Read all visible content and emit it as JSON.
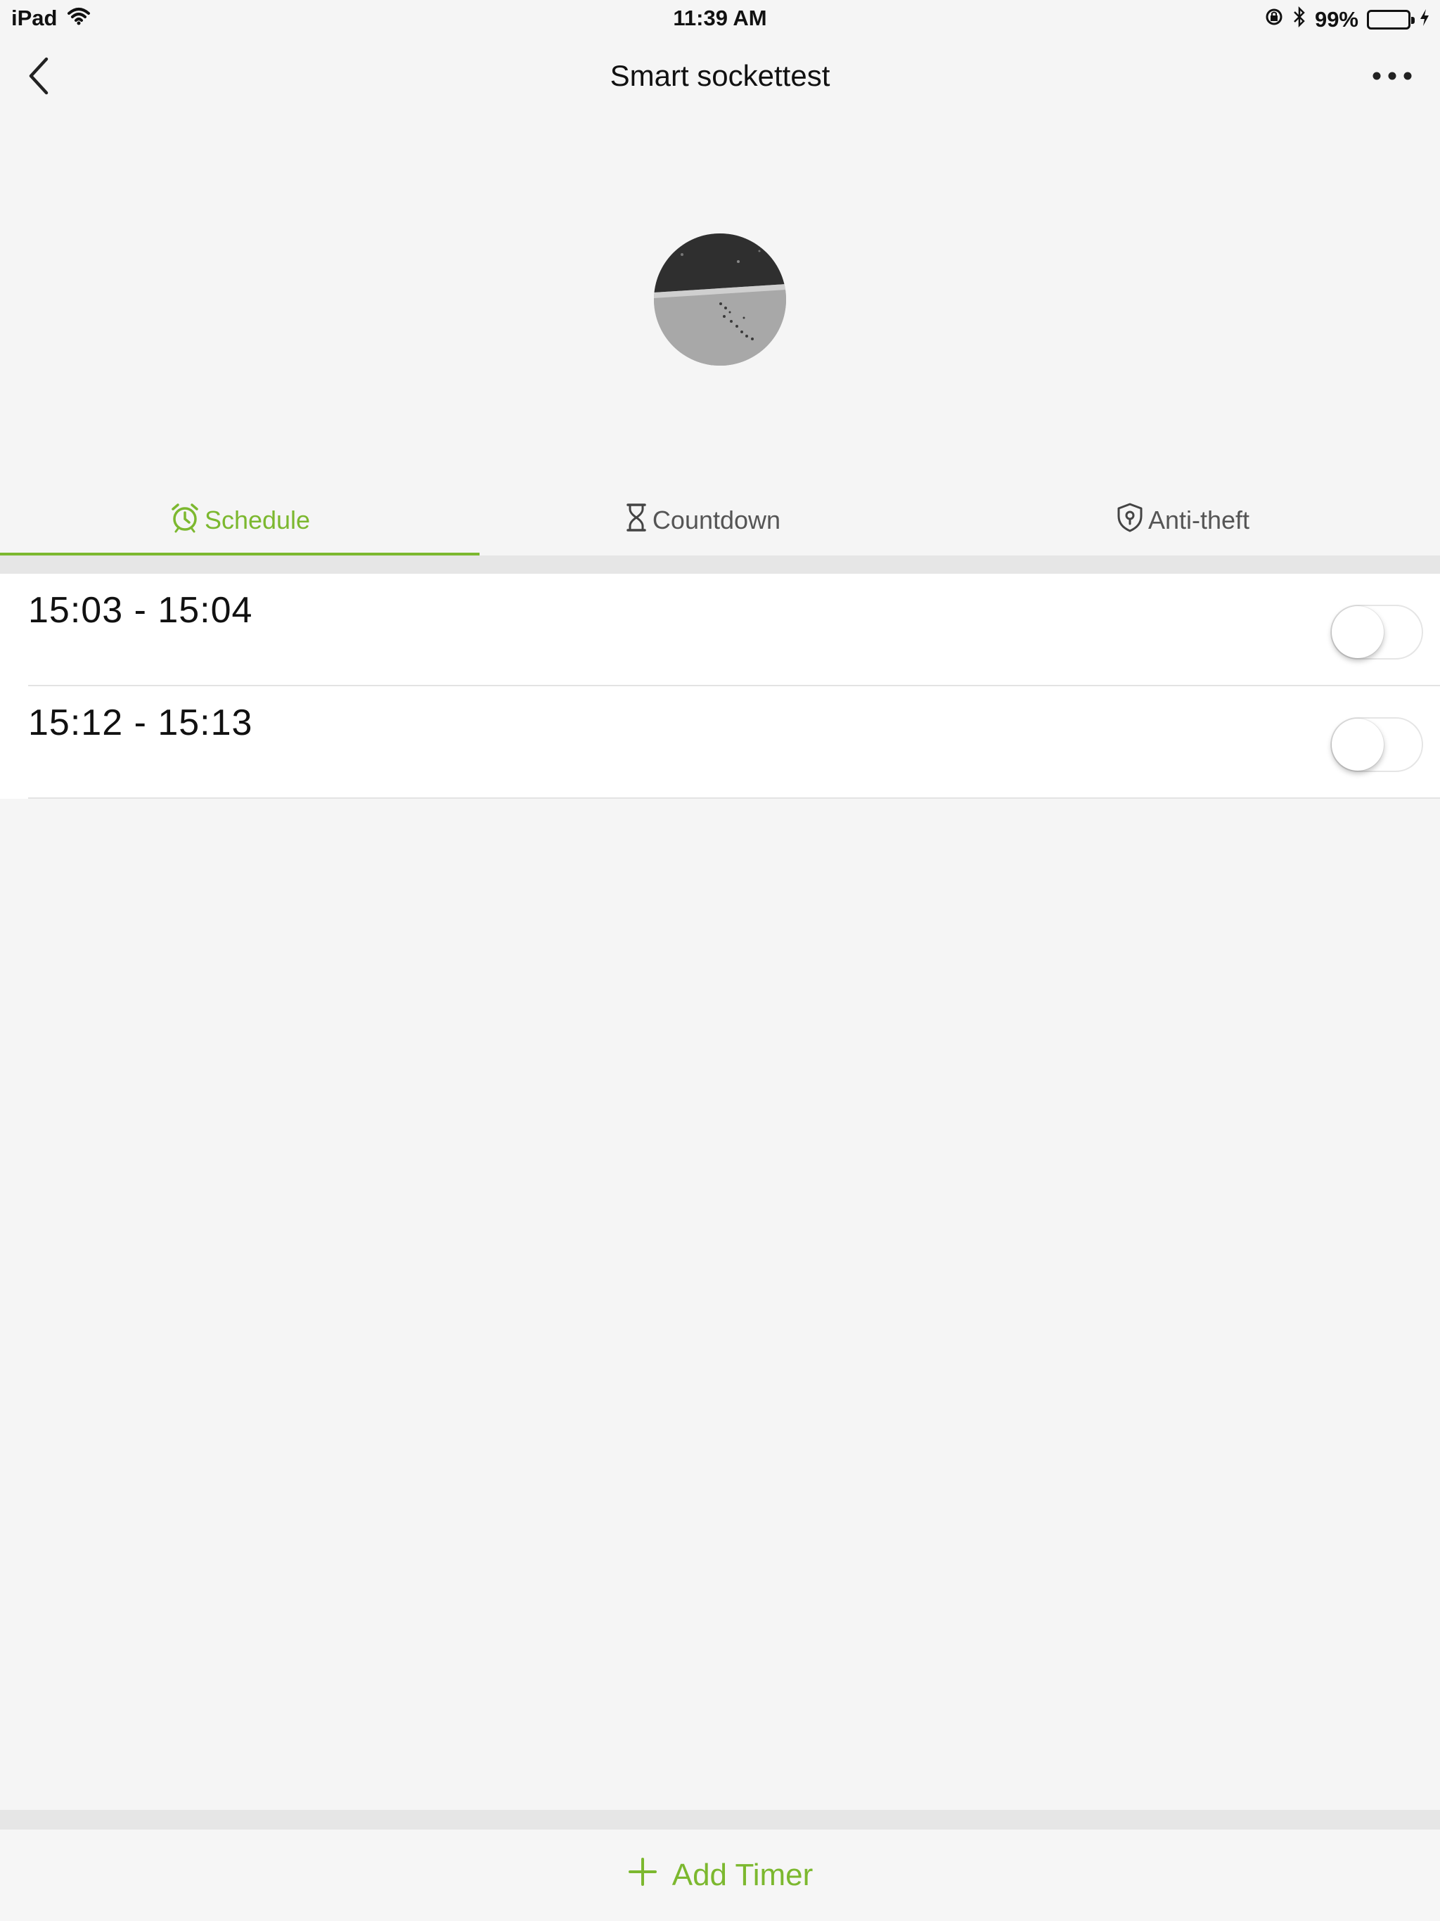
{
  "status_bar": {
    "device": "iPad",
    "time": "11:39 AM",
    "battery_percent": "99%",
    "battery_level": 0.99,
    "icons": [
      "wifi-icon",
      "orientation-lock-icon",
      "bluetooth-icon",
      "battery-icon",
      "charging-icon"
    ]
  },
  "nav": {
    "title": "Smart sockettest",
    "back_icon": "chevron-left-icon",
    "more_icon": "more-horizontal-icon"
  },
  "tabs": [
    {
      "label": "Schedule",
      "icon": "alarm-clock-icon",
      "active": true
    },
    {
      "label": "Countdown",
      "icon": "hourglass-icon",
      "active": false
    },
    {
      "label": "Anti-theft",
      "icon": "shield-icon",
      "active": false
    }
  ],
  "timers": [
    {
      "start": "15:03",
      "end": "15:04",
      "display": "15:03  - 15:04",
      "enabled": false
    },
    {
      "start": "15:12",
      "end": "15:13",
      "display": "15:12   - 15:13",
      "enabled": false
    }
  ],
  "footer": {
    "add_timer_label": "Add Timer",
    "add_icon": "plus-icon"
  },
  "colors": {
    "accent": "#7cb82f",
    "background": "#f5f5f5",
    "row_background": "#ffffff",
    "separator": "#e3e3e3",
    "battery": "#4cd964"
  }
}
